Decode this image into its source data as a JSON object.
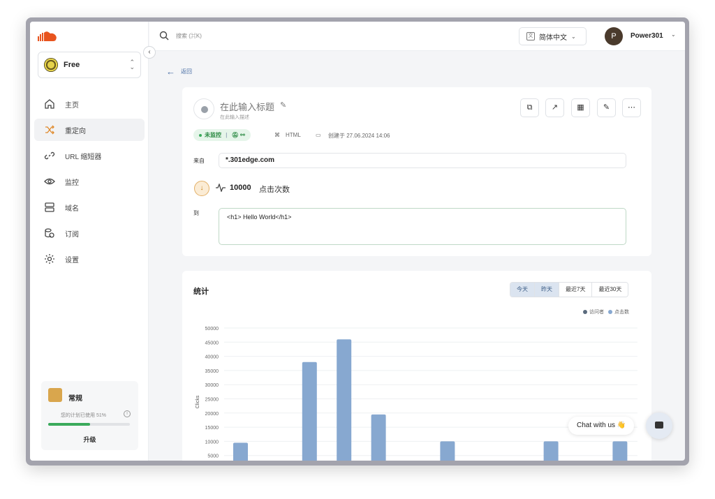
{
  "sidebar": {
    "plan": "Free",
    "items": [
      {
        "label": "主页",
        "icon": "home-icon"
      },
      {
        "label": "重定向",
        "icon": "shuffle-icon",
        "active": true
      },
      {
        "label": "URL 缩短器",
        "icon": "link-icon"
      },
      {
        "label": "监控",
        "icon": "eye-icon"
      },
      {
        "label": "域名",
        "icon": "server-icon"
      },
      {
        "label": "订阅",
        "icon": "coins-icon"
      },
      {
        "label": "设置",
        "icon": "gear-icon"
      }
    ],
    "usage": {
      "title": "常规",
      "text": "您的计划已使用 51%",
      "percent": 51,
      "upgrade": "升级"
    }
  },
  "topbar": {
    "search_placeholder": "搜索 (⌘K)",
    "language": "简体中文",
    "user_initial": "P",
    "user_name": "Power301"
  },
  "main": {
    "back": "返回",
    "link": {
      "title": "在此输入标题",
      "description": "在此输入描述",
      "status": "未监控",
      "type": "HTML",
      "created": "创建于 27.06.2024 14:06",
      "from_label": "来自",
      "from_value": "*.301edge.com",
      "clicks": "10000",
      "clicks_label": "点击次数",
      "to_label": "到",
      "to_value": "<h1> Hello World</h1>"
    },
    "stats": {
      "title": "统计",
      "ranges": [
        "今天",
        "昨天",
        "最近7天",
        "最近30天"
      ],
      "legend": [
        "访问者",
        "点击数"
      ]
    }
  },
  "chat": {
    "label": "Chat with us 👋"
  },
  "colors": {
    "accent": "#3aaa5b",
    "bar": "#87a8d0",
    "visitors": "#5a6b7d"
  },
  "chart_data": {
    "type": "bar",
    "ylabel": "Clicks",
    "yticks": [
      5000,
      10000,
      15000,
      20000,
      25000,
      30000,
      35000,
      40000,
      45000,
      50000
    ],
    "ylim": [
      0,
      50000
    ],
    "series": [
      {
        "name": "点击数",
        "values": [
          9500,
          0,
          38000,
          46000,
          19500,
          0,
          10000,
          0,
          0,
          10000,
          0,
          10000
        ]
      }
    ],
    "grid": true,
    "legend": "top-right"
  }
}
